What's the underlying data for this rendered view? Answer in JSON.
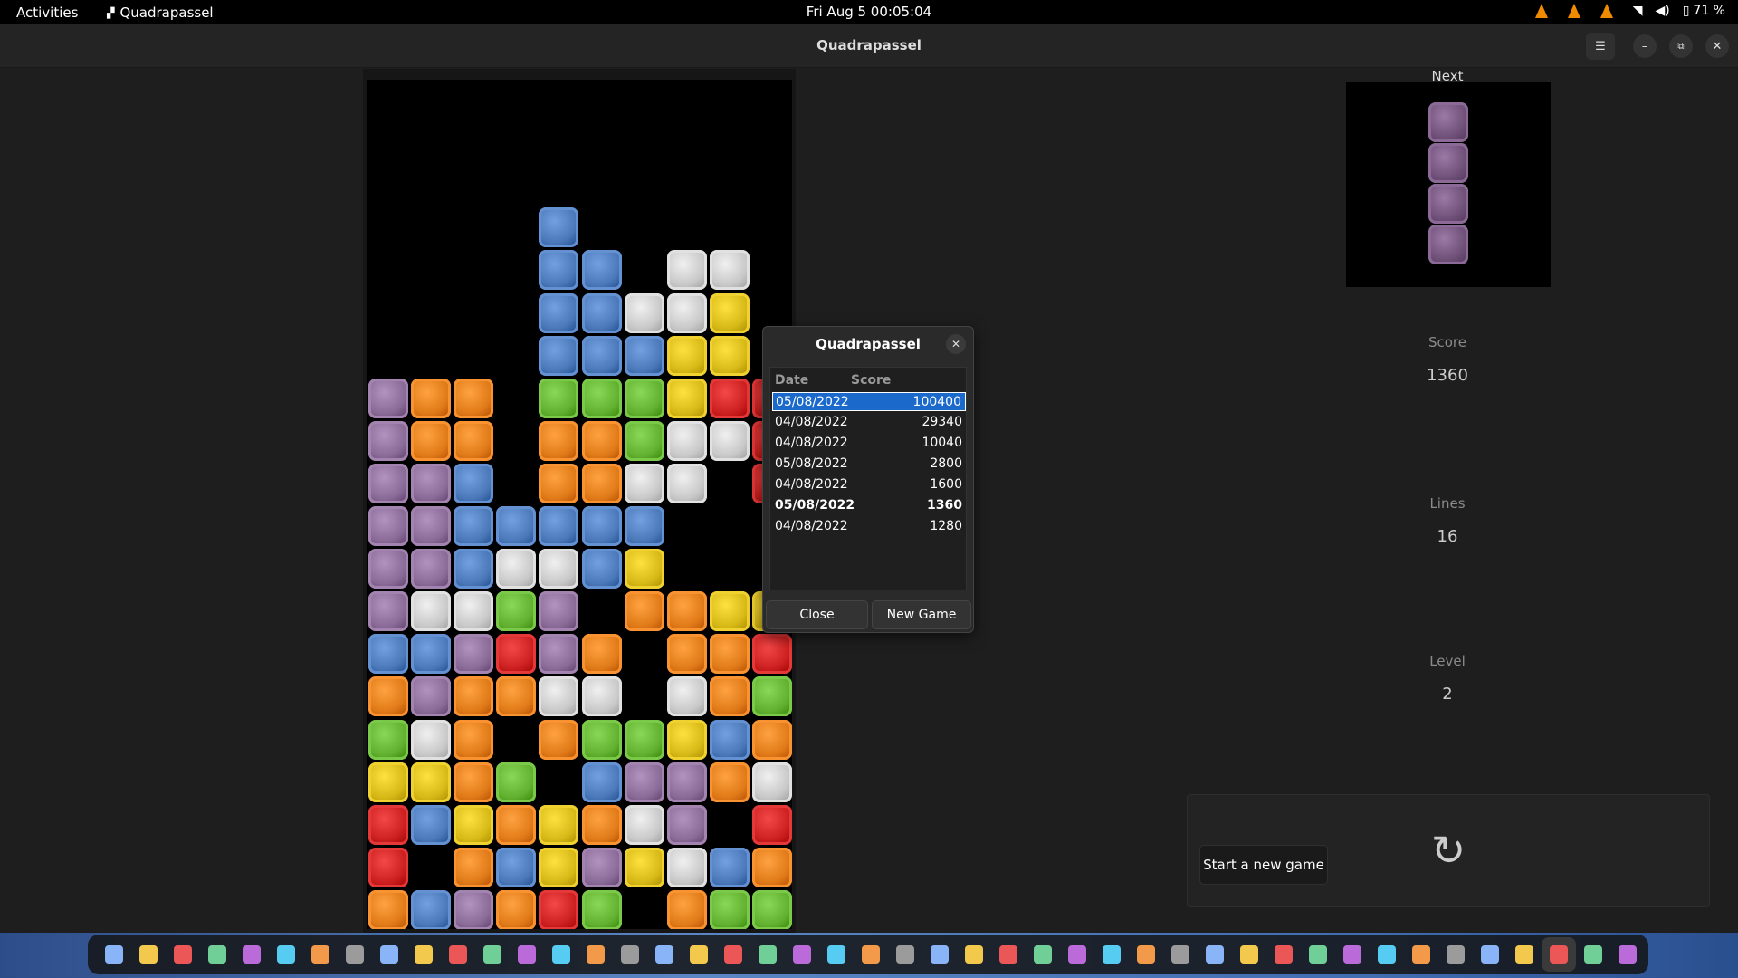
{
  "topbar": {
    "activities": "Activities",
    "app_name": "Quadrapassel",
    "clock": "Fri Aug 5  00:05:04",
    "battery": "71 %"
  },
  "header": {
    "title": "Quadrapassel"
  },
  "side": {
    "next_label": "Next",
    "score_label": "Score",
    "score_value": "1360",
    "lines_label": "Lines",
    "lines_value": "16",
    "level_label": "Level",
    "level_value": "2",
    "new_game_button": "Start a new game"
  },
  "dialog": {
    "title": "Quadrapassel",
    "col_date": "Date",
    "col_score": "Score",
    "rows": [
      {
        "date": "05/08/2022",
        "score": "100400"
      },
      {
        "date": "04/08/2022",
        "score": "29340"
      },
      {
        "date": "04/08/2022",
        "score": "10040"
      },
      {
        "date": "05/08/2022",
        "score": "2800"
      },
      {
        "date": "04/08/2022",
        "score": "1600"
      },
      {
        "date": "05/08/2022",
        "score": "1360"
      },
      {
        "date": "04/08/2022",
        "score": "1280"
      }
    ],
    "selected_row": 0,
    "current_row": 5,
    "close_button": "Close",
    "new_game_button": "New Game"
  },
  "colors": {
    "B": "#4a78b8",
    "W": "#c8c8c8",
    "Y": "#d6b816",
    "G": "#62b030",
    "R": "#cc1f1f",
    "O": "#e07a18",
    "P": "#8a6a96",
    "selection": "#1b6acb"
  },
  "board": [
    "..........",
    "..........",
    "..........",
    "....B.....",
    "....BB.WW.",
    "....BBWWY.",
    "....BBBYY.",
    "POO.GGGYRR",
    "POO.OOGWWR",
    "PPB.OOWW.R",
    "PPBBBBB...",
    "PPBWWBY...",
    "PWWGP.OOYY",
    "BBPRPO.OOR",
    "OPOOWW.WOG",
    "GWO.OGGYBO",
    "YYOG.BPPOW",
    "RBYOYOWP.R",
    "R.OBYPYWBO",
    "OBPORG.OGG"
  ],
  "next_piece": [
    "P",
    "P",
    "P",
    "P"
  ],
  "dock_icons": [
    "terminal-icon",
    "files-icon",
    "chrome-icon",
    "editor-icon",
    "notes-icon",
    "search-icon",
    "docs-icon",
    "sheets-icon",
    "shell-icon",
    "firefox-icon",
    "vlc-icon",
    "obs-icon",
    "store-icon",
    "writer-icon",
    "calc-icon",
    "help-icon",
    "monitor-icon",
    "disk-icon",
    "drone-icon",
    "up-icon",
    "cube-icon",
    "camera-icon",
    "spreadsheet-icon",
    "folder-icon",
    "book-icon",
    "calendar-icon",
    "discord-icon",
    "telegram-icon",
    "steam-icon",
    "pdf-icon",
    "percent-icon",
    "record-icon",
    "gift-icon",
    "window-icon",
    "chromium-icon",
    "word-icon",
    "disk2-icon",
    "cards-icon",
    "tool-icon",
    "game-icon",
    "chat-icon",
    "code-icon",
    "quadrapassel-icon",
    "trash-icon",
    "apps-grid-icon"
  ]
}
